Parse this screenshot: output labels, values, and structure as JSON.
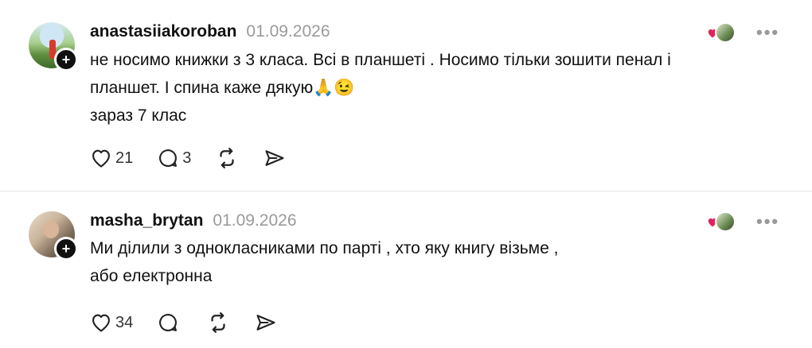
{
  "posts": [
    {
      "username": "anastasiiakoroban",
      "date": "01.09.2026",
      "lines": [
        "не носимо книжки з 3 класа. Всі в планшеті . Носимо тільки зошити пенал і",
        "планшет. І спина каже дякую🙏😉",
        "зараз 7 клас"
      ],
      "likes": "21",
      "replies": "3"
    },
    {
      "username": "masha_brytan",
      "date": "01.09.2026",
      "lines": [
        "Ми ділили з однокласниками по парті , хто яку книгу візьме ,",
        "або електронна"
      ],
      "likes": "34",
      "replies": ""
    }
  ],
  "icons": {
    "like": "heart-icon",
    "reply": "speech-bubble-icon",
    "repost": "repost-icon",
    "share": "send-icon",
    "more": "more-icon",
    "follow": "plus-icon"
  },
  "colors": {
    "liked_heart": "#e0245e",
    "muted_text": "#9a9a9a",
    "divider": "#e5e5e5"
  }
}
